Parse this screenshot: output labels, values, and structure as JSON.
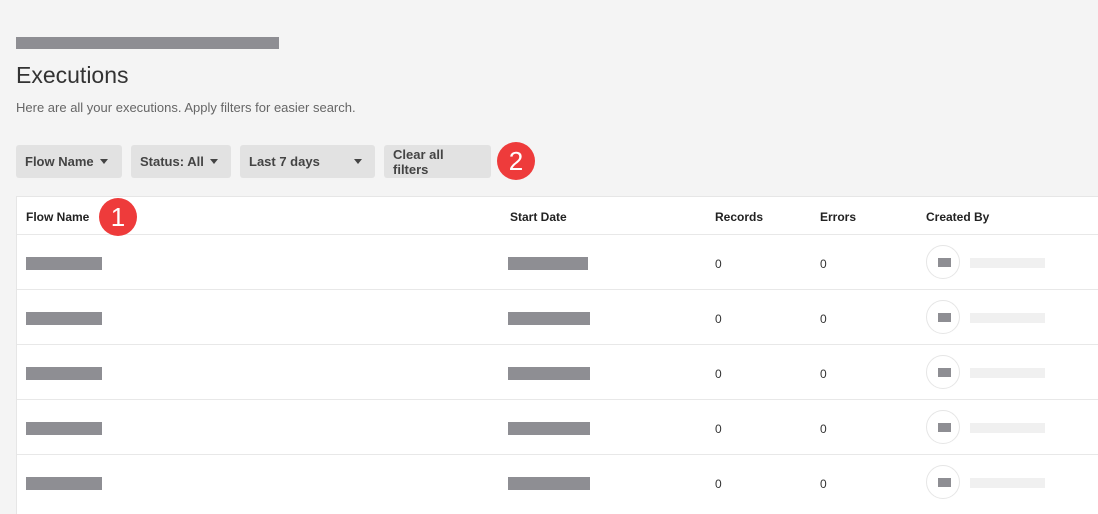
{
  "page": {
    "title": "Executions",
    "subtitle": "Here are all your executions. Apply filters for easier search."
  },
  "filters": {
    "flow_name": "Flow Name",
    "status": "Status: All",
    "date_range": "Last 7 days",
    "clear": "Clear all filters"
  },
  "annotations": [
    "1",
    "2"
  ],
  "table": {
    "columns": [
      "Flow Name",
      "Start Date",
      "Records",
      "Errors",
      "Created By"
    ],
    "rows": [
      {
        "records": "0",
        "errors": "0"
      },
      {
        "records": "0",
        "errors": "0"
      },
      {
        "records": "0",
        "errors": "0"
      },
      {
        "records": "0",
        "errors": "0"
      },
      {
        "records": "0",
        "errors": "0"
      }
    ]
  },
  "colors": {
    "accent_badge": "#ee3b3b",
    "redaction": "#8e8e93",
    "background": "#f4f4f4"
  }
}
